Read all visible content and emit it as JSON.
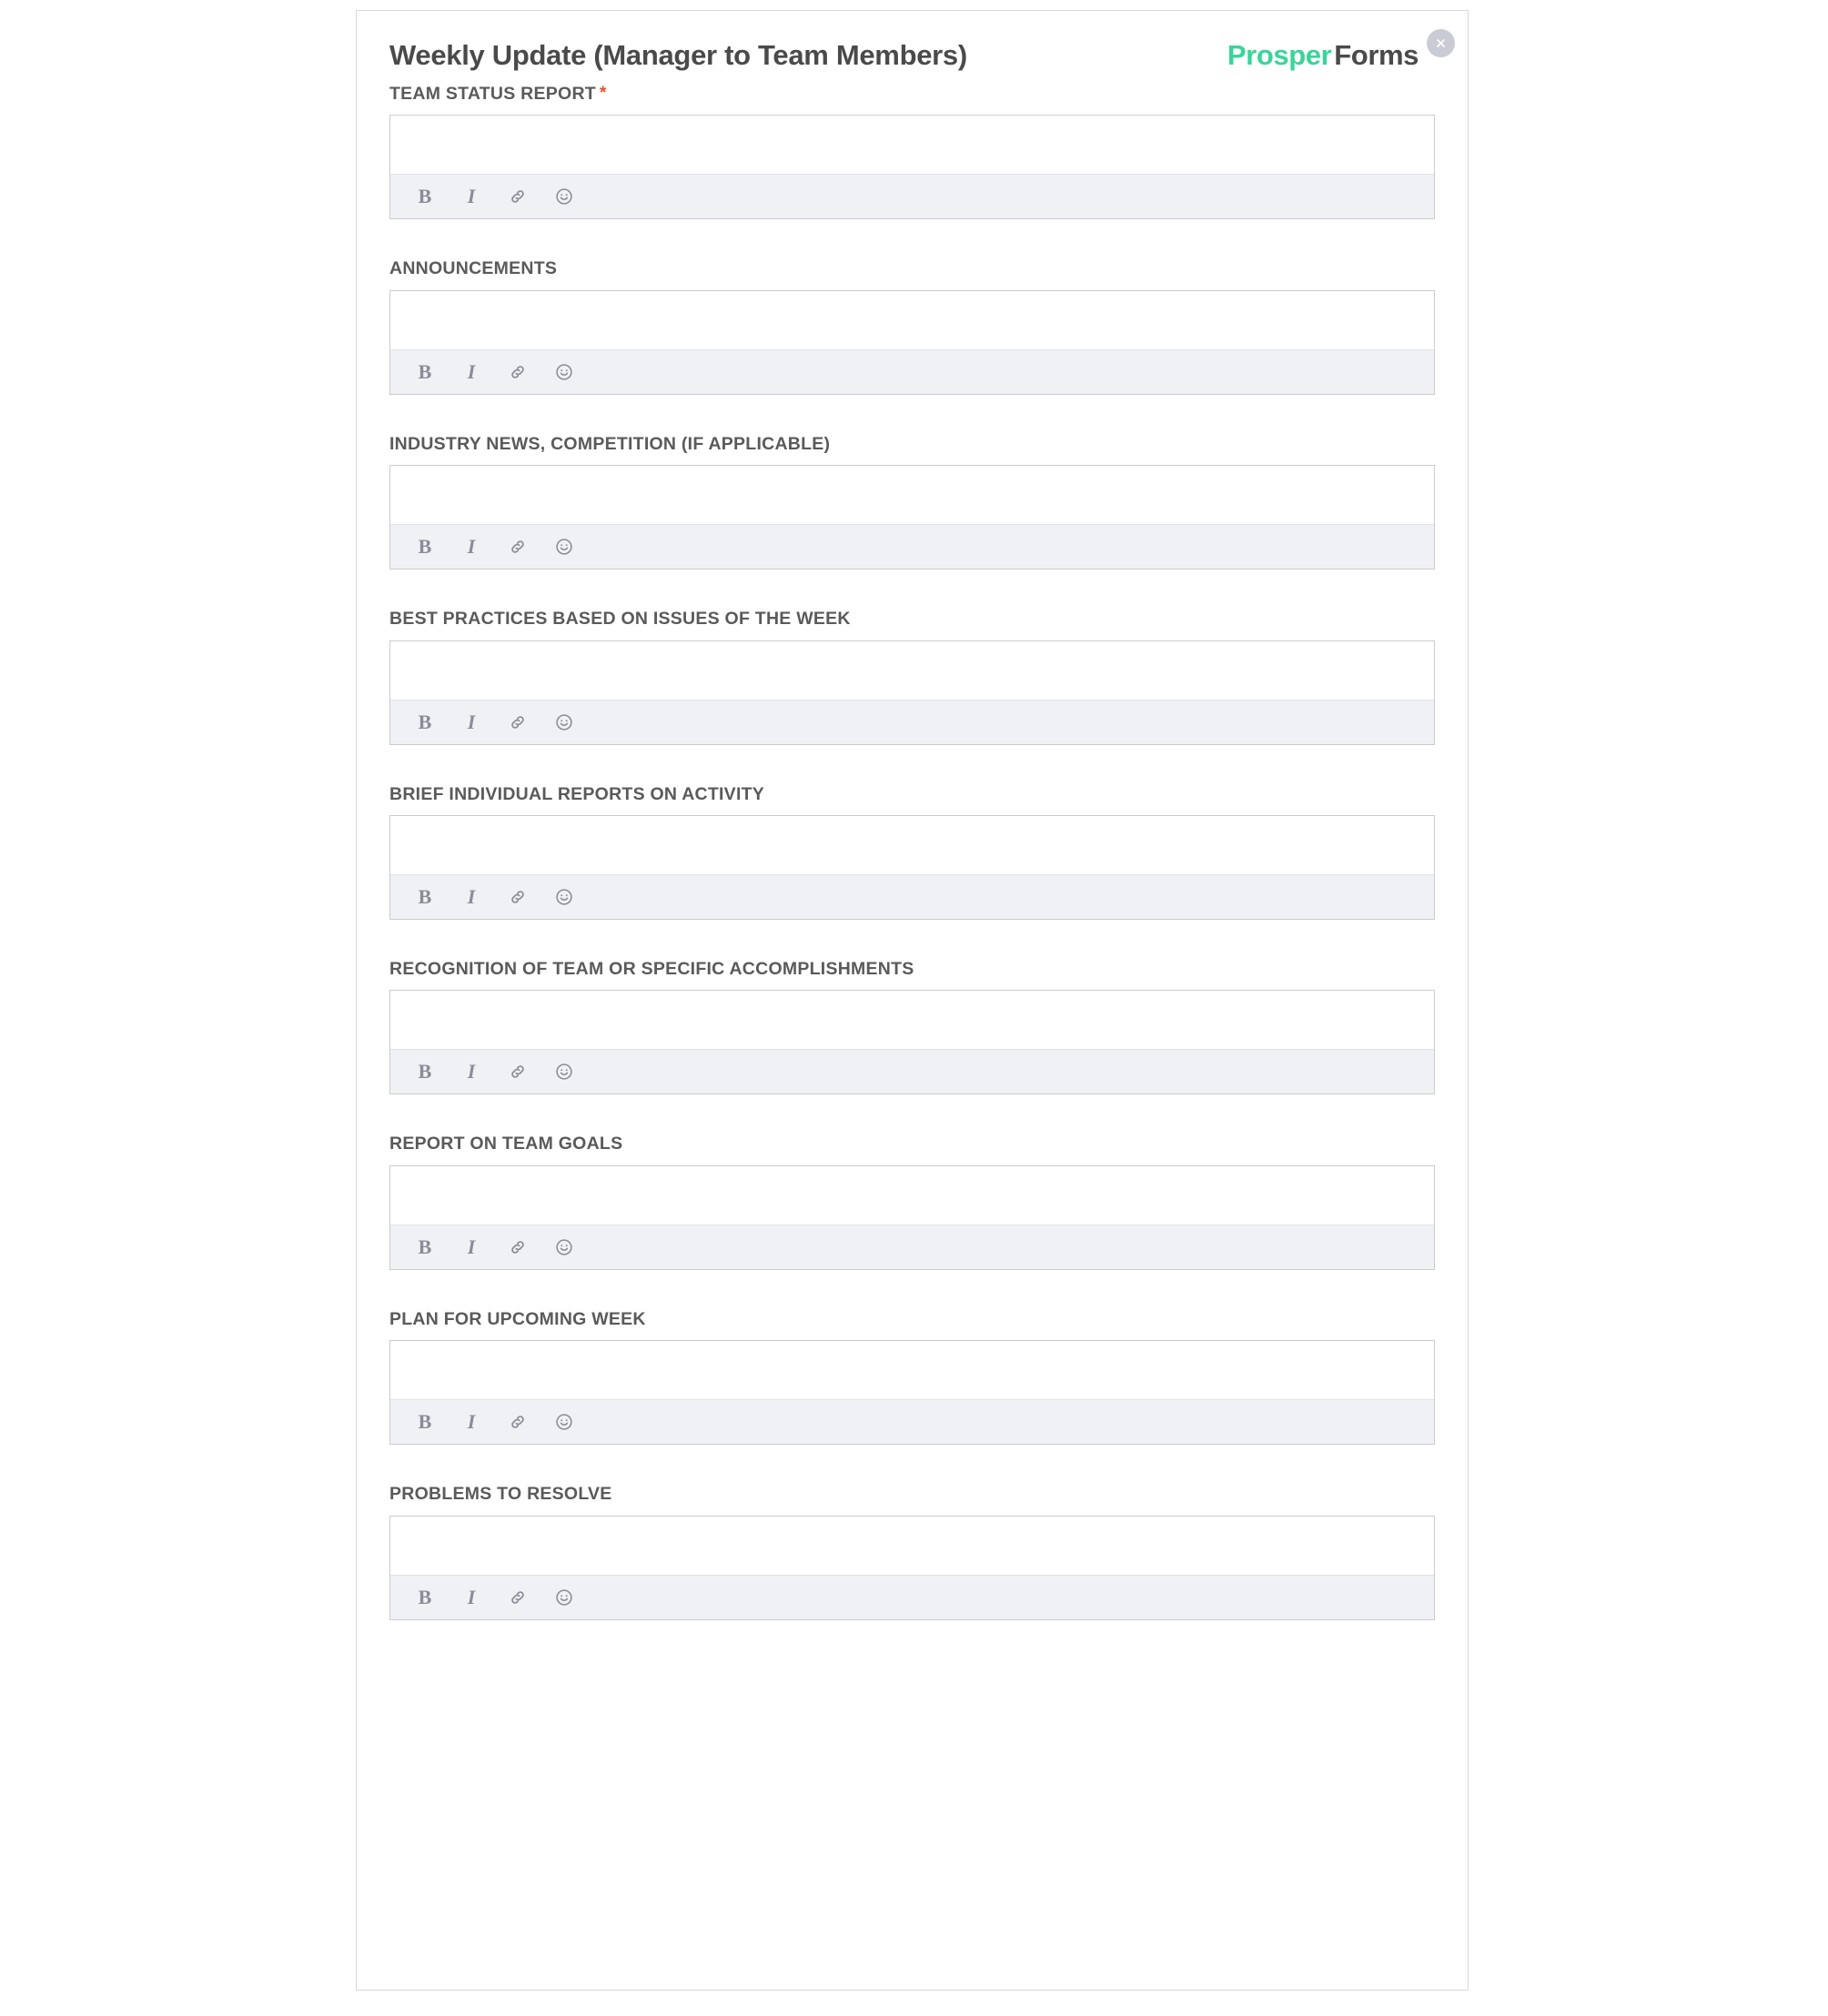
{
  "form": {
    "title": "Weekly Update (Manager to Team Members)",
    "brand": {
      "primary": "Prosper",
      "secondary": "Forms",
      "primary_color": "#3ad49a",
      "secondary_color": "#4a4a4a"
    },
    "close_label": "×",
    "required_marker": "*",
    "required_marker_color": "#e8522b",
    "toolbar": {
      "bold_label": "B",
      "italic_label": "I",
      "link_label": "link-icon",
      "emoji_label": "emoji-icon"
    },
    "fields": [
      {
        "label": "TEAM STATUS REPORT",
        "required": true,
        "value": ""
      },
      {
        "label": "ANNOUNCEMENTS",
        "required": false,
        "value": ""
      },
      {
        "label": "INDUSTRY NEWS, COMPETITION (IF APPLICABLE)",
        "required": false,
        "value": ""
      },
      {
        "label": "BEST PRACTICES BASED ON ISSUES OF THE WEEK",
        "required": false,
        "value": ""
      },
      {
        "label": "BRIEF INDIVIDUAL REPORTS ON ACTIVITY",
        "required": false,
        "value": ""
      },
      {
        "label": "RECOGNITION OF TEAM OR SPECIFIC ACCOMPLISHMENTS",
        "required": false,
        "value": ""
      },
      {
        "label": "REPORT ON TEAM GOALS",
        "required": false,
        "value": ""
      },
      {
        "label": "PLAN FOR UPCOMING WEEK",
        "required": false,
        "value": ""
      },
      {
        "label": "PROBLEMS TO RESOLVE",
        "required": false,
        "value": ""
      }
    ]
  }
}
